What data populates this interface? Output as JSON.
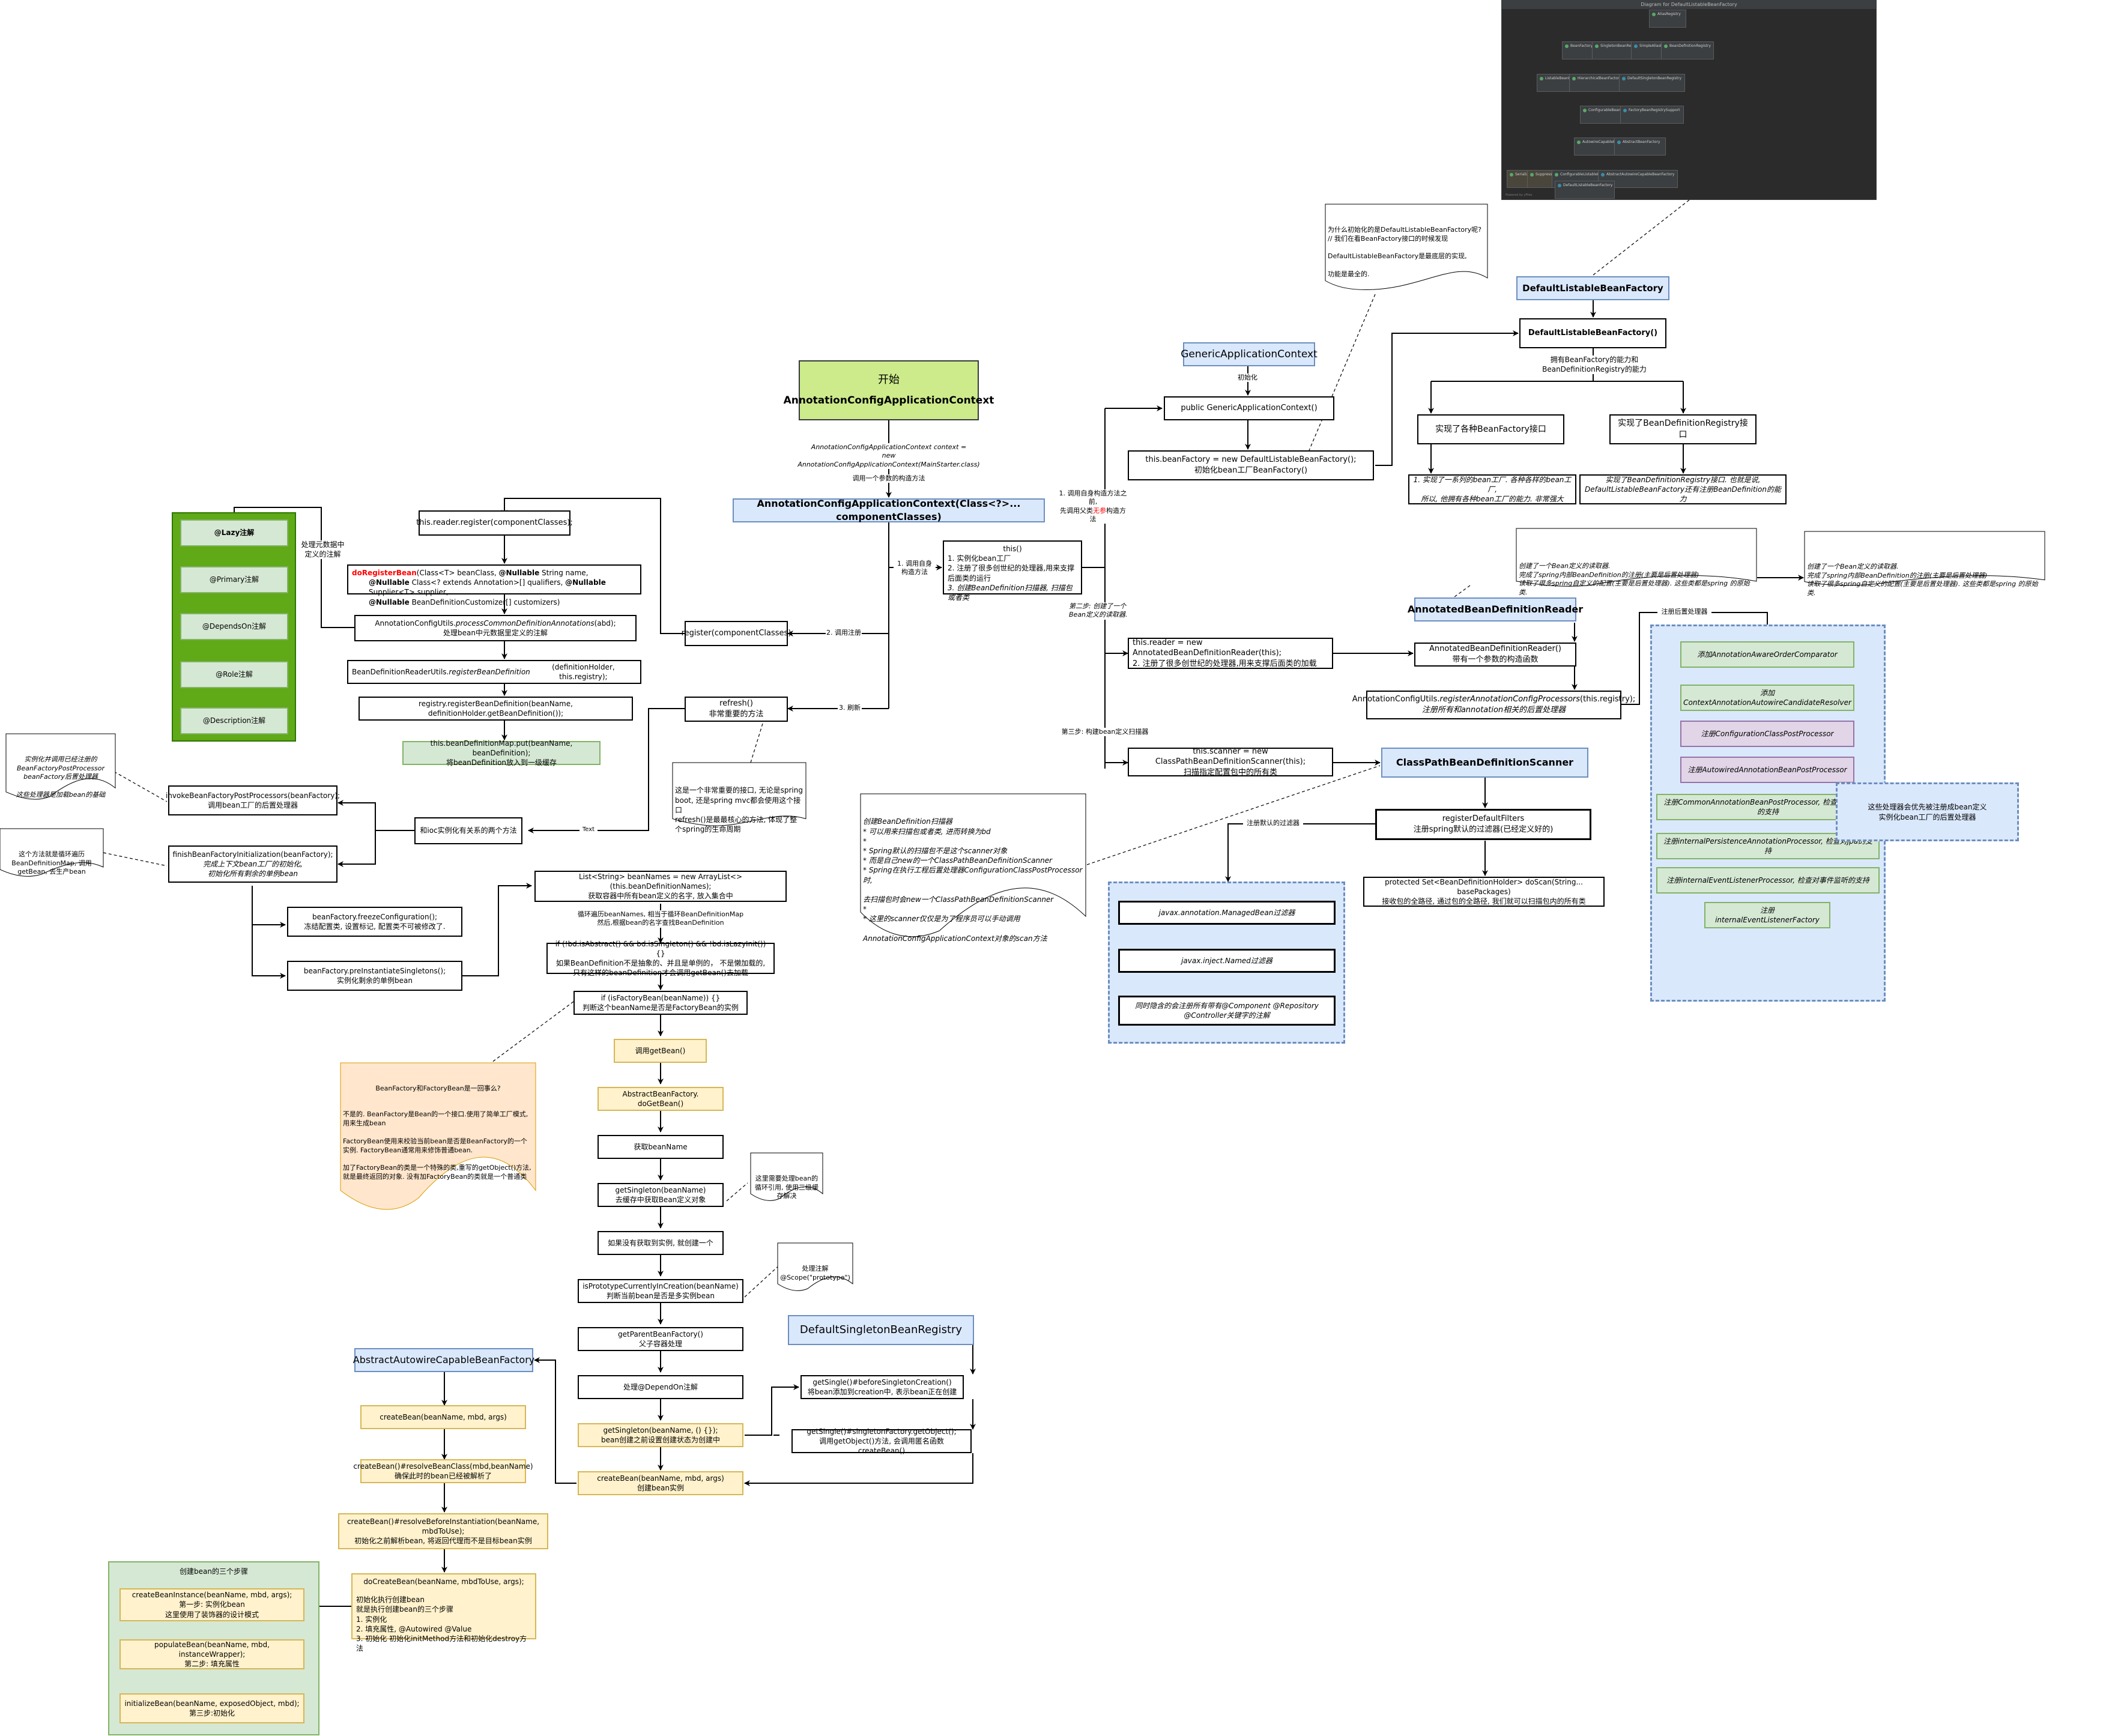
{
  "diagram": {
    "start": {
      "line1": "开始",
      "line2": "AnnotationConfigApplicationContext"
    },
    "start_edge_label": "AnnotationConfigApplicationContext context =\nnew AnnotationConfigApplicationContext(MainStarter.class)",
    "ctor_edge_label": "调用一个参数的构造方法",
    "ctor_node": "AnnotationConfigApplicationContext(Class<?>... componentClasses)",
    "this_node": {
      "title": "this()",
      "l1": "1. 实例化bean工厂",
      "l2": "2. 注册了很多创世纪的处理器,用来支撑后面类的运行",
      "l3": "3. 创建BeanDefinition扫描器, 扫描包或者类"
    },
    "edge_call_self_ctor": "1. 调用自身\n构造方法",
    "edge_register": "2. 调用注册",
    "edge_refresh": "3. 刷新",
    "register_node": "register(componentClasses)",
    "refresh_node": "refresh()\n非常重要的方法",
    "refresh_note": "这是一个非常重要的接口, 无论是spring boot, 还是spring mvc都会使用这个接口\nrefresh()是最最核心的方法, 体现了整个spring的生命周期",
    "edge_parent_ctor": {
      "pre": "1. 调用自身构造方法之前,\n先调用父类",
      "red": "无参",
      "post": "构造方法"
    },
    "generic_ctx": "GenericApplicationContext",
    "generic_edge": "初始化",
    "generic_ctor": "public GenericApplicationContext()",
    "bean_factory_init": "this.beanFactory = new DefaultListableBeanFactory();\n初始化bean工厂BeanFactory()",
    "why_note": "为什么初始化的是DefaultListableBeanFactory呢?\n// 我们在看BeanFactory接口的时候发现\n\nDefaultListableBeanFactory是最底层的实现,\n\n功能是最全的.",
    "dlbf_title": "DefaultListableBeanFactory",
    "dlbf_ctor": "DefaultListableBeanFactory()",
    "dlbf_edge": "拥有BeanFactory的能力和\nBeanDefinitionRegistry的能力",
    "impl_bf": "实现了各种BeanFactory接口",
    "impl_bdr": "实现了BeanDefinitionRegistry接口",
    "impl_bf_desc": "1. 实现了一系列的bean工厂. 各种各样的bean工厂,\n所以, 他拥有各种bean工厂的能力. 非常强大",
    "impl_bdr_desc": "实现了BeanDefinitionRegistry接口. 也就是说,\nDefaultListableBeanFactory还有注册BeanDefinition的能力",
    "ide_diagram": {
      "title": "Diagram for DefaultListableBeanFactory",
      "footer": "Powered by yFiles",
      "classes": [
        "AliasRegistry",
        "BeanFactory",
        "SingletonBeanRegistry",
        "SimpleAliasRegistry",
        "BeanDefinitionRegistry",
        "ListableBeanFactory",
        "HierarchicalBeanFactory",
        "DefaultSingletonBeanRegistry",
        "ConfigurableBeanFactory",
        "FactoryBeanRegistrySupport",
        "AutowireCapableBeanFactory",
        "AbstractBeanFactory",
        "Serializable",
        "SuppressWarnings",
        "ConfigurableListableBeanFactory",
        "AbstractAutowireCapableBeanFactory",
        "DefaultListableBeanFactory"
      ]
    },
    "step2_label": "第二步: 创建了一个\nBean定义的读取器.",
    "step3_label": "第三步: 构建bean定义扫描器",
    "reader_node": "this.reader = new AnnotatedBeanDefinitionReader(this);\n2. 注册了很多创世纪的处理器,用来支撑后面类的加载",
    "abdr_title": "AnnotatedBeanDefinitionReader",
    "abdr_ctor": "AnnotatedBeanDefinitionReader()\n带有一个参数的构造函数",
    "acu_register": {
      "pre": "AnnotationConfigUtils.",
      "method": "registerAnnotationConfigProcessors",
      "post": "(this.registry);",
      "l2": "注册所有和annotation相关的后置处理器"
    },
    "reader_note": "创建了一个Bean定义的读取器.\n完成了spring内部BeanDefinition的注册(主要是后置处理器)\n读取了很多spring自定义的配置(主要是后置处理器). 这些类都是spring 的原始类.",
    "reader_note2": "创建了一个Bean定义的读取器.\n完成了spring内部BeanDefinition的注册(主要是后置处理器)\n读取了很多spring自定义的配置(主要是后置处理器). 这些类都是spring 的原始类.",
    "register_pp_label": "注册后置处理器",
    "processors": [
      {
        "text": "添加AnnotationAwareOrderComparator",
        "color": "green"
      },
      {
        "text": "添加ContextAnnotationAutowireCandidateResolver",
        "color": "green"
      },
      {
        "text": "注册ConfigurationClassPostProcessor",
        "color": "purple"
      },
      {
        "text": "注册AutowiredAnnotationBeanPostProcessor",
        "color": "purple"
      },
      {
        "text": "注册CommonAnnotationBeanPostProcessor, 检查对JSR-250的支持",
        "color": "green"
      },
      {
        "text": "注册internalPersistenceAnnotationProcessor, 检查对jpa的支持",
        "color": "green"
      },
      {
        "text": "注册internalEventListenerProcessor, 检查对事件监听的支持",
        "color": "green"
      },
      {
        "text": "注册internalEventListenerFactory",
        "color": "green"
      }
    ],
    "processors_note": "这些处理器会优先被注册成bean定义\n实例化bean工厂的后置处理器",
    "scanner_node": "this.scanner = new ClassPathBeanDefinitionScanner(this);\n扫描指定配置包中的所有类",
    "cpbds_title": "ClassPathBeanDefinitionScanner",
    "scanner_note": "创建BeanDefinition扫描器\n* 可以用来扫描包或者类, 进而转换为bd\n*\n* Spring默认的扫描包不是这个scanner对象\n* 而是自己new的一个ClassPathBeanDefinitionScanner\n* Spring在执行工程后置处理器ConfigurationClassPostProcessor时,\n\n  去扫描包时会new一个ClassPathBeanDefinitionScanner\n*\n* 这里的scanner仅仅是为了程序员可以手动调用\n\n  AnnotationConfigApplicationContext对象的scan方法",
    "register_filters": "registerDefaultFilters\n注册spring默认的过滤器(已经定义好的)",
    "filters_edge": "注册默认的过滤器",
    "filters": [
      "javax.annotation.ManagedBean过滤器",
      "javax.inject.Named过滤器",
      "同时隐含的会注册所有带有@Component @Repository\n@Controller关键字的注解"
    ],
    "do_scan": "protected Set<BeanDefinitionHolder> doScan(String... basePackages)\n接收包的全路径, 通过包的全路径, 我们就可以扫描包内的所有类",
    "reader_register": "this.reader.register(componentClasses);",
    "do_register_bean": {
      "red": "doRegisterBean",
      "rest1": "(Class<T> beanClass, ",
      "nb": "@Nullable",
      "rest2": " String name,",
      "l2a": "@Nullable",
      "l2b": " Class<? extends Annotation>[] qualifiers, ",
      "l2c": "@Nullable",
      "l2d": " Supplier<T> supplier,",
      "l3a": "@Nullable",
      "l3b": " BeanDefinitionCustomizer[] customizers)"
    },
    "process_common": {
      "pre": "AnnotationConfigUtils.",
      "method": "processCommonDefinitionAnnotations",
      "post": "(abd);",
      "l2": "处理bean中元数据里定义的注解"
    },
    "process_edge": "处理元数据中\n定义的注解",
    "annotations": [
      "@Lazy注解",
      "@Primary注解",
      "@DependsOn注解",
      "@Role注解",
      "@Description注解"
    ],
    "bdru": {
      "pre": "BeanDefinitionReaderUtils.",
      "method": "registerBeanDefinition",
      "post": "(definitionHolder, this.registry);"
    },
    "registry_register": "registry.registerBeanDefinition(beanName, definitionHolder.getBeanDefinition());",
    "bdmap_put": "this.beanDefinitionMap.put(beanName, beanDefinition);\n将beanDefinition放入到一级缓存",
    "ioc_methods": "和ioc实例化有关系的两个方法",
    "ioc_edge": "Text",
    "invoke_bfpp": "invokeBeanFactoryPostProcessors(beanFactory);\n调用bean工厂的后置处理器",
    "invoke_note": "实例化并调用已经注册的\nBeanFactoryPostProcessor\nbeanFactory后置处理器\n\n这些处理器是加载bean的基础",
    "finish_init": {
      "l1": "finishBeanFactoryInitialization(beanFactory);",
      "l2": "完成上下文bean工厂的初始化,\n初始化所有剩余的单例bean"
    },
    "finish_note": "这个方法就是循环遍历\nBeanDefinitionMap, 调用\ngetBean, 去生产bean",
    "freeze": "beanFactory.freezeConfiguration();\n冻结配置类, 设置标记, 配置类不可被修改了.",
    "pre_inst": "beanFactory.preInstantiateSingletons();\n实例化剩余的单例bean",
    "bean_names": "List<String> beanNames = new ArrayList<>(this.beanDefinitionNames);\n获取容器中所有bean定义的名字, 放入集合中",
    "loop_edge": "循环遍历beanNames, 相当于循环BeanDefinitionMap\n然后,根据bean的名字查找BeanDefinition",
    "if_abstract": "if (!bd.isAbstract() && bd.isSingleton() && !bd.isLazyInit()) {}\n如果BeanDefinition不是抽象的、并且是单例的， 不是懒加载的,\n只有这样的beanDefinition才会调用getBean()去加载",
    "if_factory": "if (isFactoryBean(beanName)) {}\n判断这个beanName是否是FactoryBean的实例",
    "factory_note": {
      "title": "BeanFactory和FactoryBean是一回事么?",
      "body": "不是的. BeanFactory是Bean的一个接口.使用了简单工厂模式, 用来生成bean\n\nFactoryBean使用来校验当前bean是否是BeanFactory的一个实例. FactoryBean通常用来修饰普通bean.\n\n加了FactoryBean的类是一个特殊的类,重写的getObject()方法, 就是最终返回的对象. 没有加FactoryBean的类就是一个普通类"
    },
    "call_get_bean": "调用getBean()",
    "do_get_bean": "AbstractBeanFactory. doGetBean()",
    "get_bean_name": "获取beanName",
    "get_singleton": "getSingleton(beanName)\n去缓存中获取Bean定义对象",
    "singleton_note": "这里需要处理bean的\n循环引用, 使用三级缓\n存解决",
    "create_if_none": "如果没有获取到实例, 就创建一个",
    "is_prototype": "isPrototypeCurrentlyInCreation(beanName)\n判断当前bean是否是多实例bean",
    "scope_note": "处理注解\n@Scope(\"prototype\")",
    "parent_factory": "getParentBeanFactory()\n父子容器处理",
    "depend_on": "处理@DependOn注解",
    "get_singleton2": "getSingleton(beanName, () {});\nbean创建之前设置创建状态为创建中",
    "create_bean_main": "createBean(beanName, mbd, args)\n创建bean实例",
    "dsbr_title": "DefaultSingletonBeanRegistry",
    "before_creation": "getSingle()#beforeSingletonCreation()\n将bean添加到creation中, 表示bean正在创建",
    "get_object": "getSingle()#singletonFactory.getObject();\n调用getObject()方法, 会调用匿名函数createBean()",
    "aacbf_title": "AbstractAutowireCapableBeanFactory",
    "create_bean": "createBean(beanName, mbd, args)",
    "resolve_class": "createBean()#resolveBeanClass(mbd,beanName)\n确保此时的bean已经被解析了",
    "resolve_before": "createBean()#resolveBeforeInstantiation(beanName,\nmbdToUse);\n初始化之前解析bean, 将返回代理而不是目标bean实例",
    "do_create_bean": {
      "title": "doCreateBean(beanName, mbdToUse, args);",
      "body": "初始化执行创建bean\n就是执行创建bean的三个步骤\n1. 实例化\n2. 填充属性, @Autowired @Value\n3. 初始化 初始化initMethod方法和初始化destroy方法"
    },
    "three_steps": {
      "title": "创建bean的三个步骤",
      "steps": [
        "createBeanInstance(beanName, mbd, args);\n第一步: 实例化bean\n这里使用了装饰器的设计模式",
        "populateBean(beanName, mbd, instanceWrapper);\n第二步: 填充属性",
        "initializeBean(beanName, exposedObject, mbd);\n第三步:初始化"
      ]
    }
  }
}
